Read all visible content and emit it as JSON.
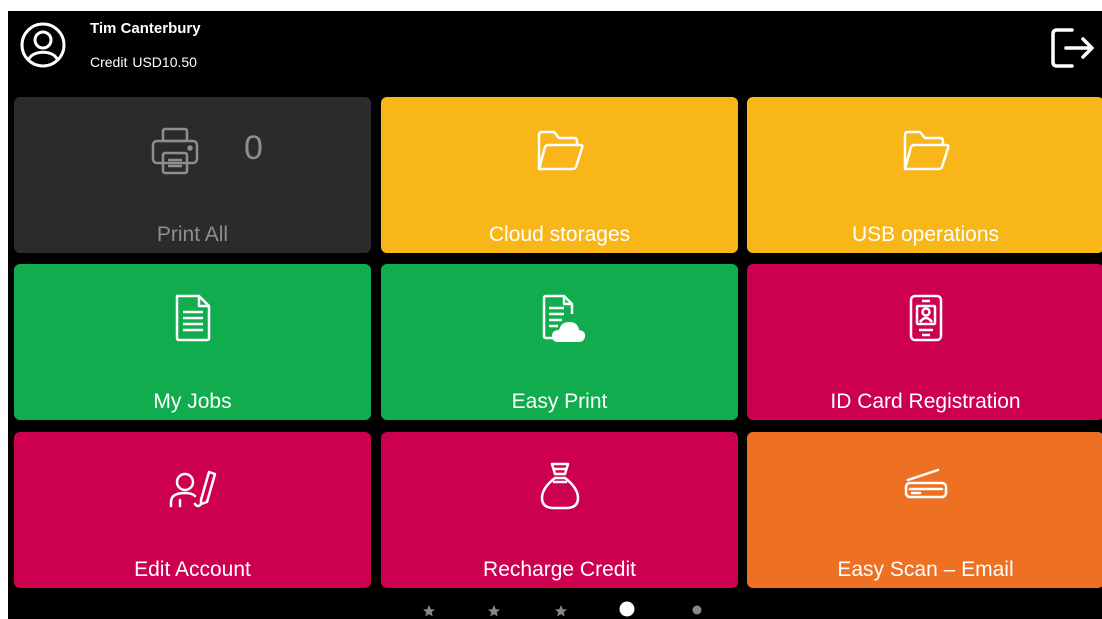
{
  "user": {
    "name": "Tim Canterbury",
    "credit_label": "Credit",
    "credit_value": "USD10.50"
  },
  "tiles": [
    {
      "label": "Print All",
      "icon": "printer-icon",
      "color": "#2b2b2b",
      "count": "0"
    },
    {
      "label": "Cloud storages",
      "icon": "folder-icon",
      "color": "#f9b619"
    },
    {
      "label": "USB operations",
      "icon": "folder-icon",
      "color": "#f9b619"
    },
    {
      "label": "My Jobs",
      "icon": "document-icon",
      "color": "#11ac4d"
    },
    {
      "label": "Easy Print",
      "icon": "document-cloud-icon",
      "color": "#11ac4d"
    },
    {
      "label": "ID Card Registration",
      "icon": "id-card-icon",
      "color": "#cc004f"
    },
    {
      "label": "Edit Account",
      "icon": "user-edit-icon",
      "color": "#cc004f"
    },
    {
      "label": "Recharge Credit",
      "icon": "money-bag-icon",
      "color": "#cc004f"
    },
    {
      "label": "Easy Scan – Email",
      "icon": "scanner-icon",
      "color": "#ee7023"
    }
  ],
  "pager": {
    "pages": 5,
    "current": 4,
    "page_icons": [
      "star-icon",
      "star-icon",
      "star-icon",
      "circle-icon",
      "circle-icon"
    ]
  }
}
